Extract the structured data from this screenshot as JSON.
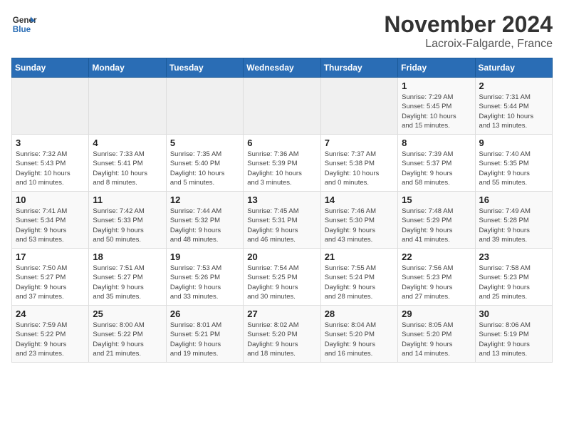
{
  "logo": {
    "line1": "General",
    "line2": "Blue"
  },
  "title": "November 2024",
  "location": "Lacroix-Falgarde, France",
  "days_of_week": [
    "Sunday",
    "Monday",
    "Tuesday",
    "Wednesday",
    "Thursday",
    "Friday",
    "Saturday"
  ],
  "weeks": [
    [
      {
        "day": "",
        "info": ""
      },
      {
        "day": "",
        "info": ""
      },
      {
        "day": "",
        "info": ""
      },
      {
        "day": "",
        "info": ""
      },
      {
        "day": "",
        "info": ""
      },
      {
        "day": "1",
        "info": "Sunrise: 7:29 AM\nSunset: 5:45 PM\nDaylight: 10 hours\nand 15 minutes."
      },
      {
        "day": "2",
        "info": "Sunrise: 7:31 AM\nSunset: 5:44 PM\nDaylight: 10 hours\nand 13 minutes."
      }
    ],
    [
      {
        "day": "3",
        "info": "Sunrise: 7:32 AM\nSunset: 5:43 PM\nDaylight: 10 hours\nand 10 minutes."
      },
      {
        "day": "4",
        "info": "Sunrise: 7:33 AM\nSunset: 5:41 PM\nDaylight: 10 hours\nand 8 minutes."
      },
      {
        "day": "5",
        "info": "Sunrise: 7:35 AM\nSunset: 5:40 PM\nDaylight: 10 hours\nand 5 minutes."
      },
      {
        "day": "6",
        "info": "Sunrise: 7:36 AM\nSunset: 5:39 PM\nDaylight: 10 hours\nand 3 minutes."
      },
      {
        "day": "7",
        "info": "Sunrise: 7:37 AM\nSunset: 5:38 PM\nDaylight: 10 hours\nand 0 minutes."
      },
      {
        "day": "8",
        "info": "Sunrise: 7:39 AM\nSunset: 5:37 PM\nDaylight: 9 hours\nand 58 minutes."
      },
      {
        "day": "9",
        "info": "Sunrise: 7:40 AM\nSunset: 5:35 PM\nDaylight: 9 hours\nand 55 minutes."
      }
    ],
    [
      {
        "day": "10",
        "info": "Sunrise: 7:41 AM\nSunset: 5:34 PM\nDaylight: 9 hours\nand 53 minutes."
      },
      {
        "day": "11",
        "info": "Sunrise: 7:42 AM\nSunset: 5:33 PM\nDaylight: 9 hours\nand 50 minutes."
      },
      {
        "day": "12",
        "info": "Sunrise: 7:44 AM\nSunset: 5:32 PM\nDaylight: 9 hours\nand 48 minutes."
      },
      {
        "day": "13",
        "info": "Sunrise: 7:45 AM\nSunset: 5:31 PM\nDaylight: 9 hours\nand 46 minutes."
      },
      {
        "day": "14",
        "info": "Sunrise: 7:46 AM\nSunset: 5:30 PM\nDaylight: 9 hours\nand 43 minutes."
      },
      {
        "day": "15",
        "info": "Sunrise: 7:48 AM\nSunset: 5:29 PM\nDaylight: 9 hours\nand 41 minutes."
      },
      {
        "day": "16",
        "info": "Sunrise: 7:49 AM\nSunset: 5:28 PM\nDaylight: 9 hours\nand 39 minutes."
      }
    ],
    [
      {
        "day": "17",
        "info": "Sunrise: 7:50 AM\nSunset: 5:27 PM\nDaylight: 9 hours\nand 37 minutes."
      },
      {
        "day": "18",
        "info": "Sunrise: 7:51 AM\nSunset: 5:27 PM\nDaylight: 9 hours\nand 35 minutes."
      },
      {
        "day": "19",
        "info": "Sunrise: 7:53 AM\nSunset: 5:26 PM\nDaylight: 9 hours\nand 33 minutes."
      },
      {
        "day": "20",
        "info": "Sunrise: 7:54 AM\nSunset: 5:25 PM\nDaylight: 9 hours\nand 30 minutes."
      },
      {
        "day": "21",
        "info": "Sunrise: 7:55 AM\nSunset: 5:24 PM\nDaylight: 9 hours\nand 28 minutes."
      },
      {
        "day": "22",
        "info": "Sunrise: 7:56 AM\nSunset: 5:23 PM\nDaylight: 9 hours\nand 27 minutes."
      },
      {
        "day": "23",
        "info": "Sunrise: 7:58 AM\nSunset: 5:23 PM\nDaylight: 9 hours\nand 25 minutes."
      }
    ],
    [
      {
        "day": "24",
        "info": "Sunrise: 7:59 AM\nSunset: 5:22 PM\nDaylight: 9 hours\nand 23 minutes."
      },
      {
        "day": "25",
        "info": "Sunrise: 8:00 AM\nSunset: 5:22 PM\nDaylight: 9 hours\nand 21 minutes."
      },
      {
        "day": "26",
        "info": "Sunrise: 8:01 AM\nSunset: 5:21 PM\nDaylight: 9 hours\nand 19 minutes."
      },
      {
        "day": "27",
        "info": "Sunrise: 8:02 AM\nSunset: 5:20 PM\nDaylight: 9 hours\nand 18 minutes."
      },
      {
        "day": "28",
        "info": "Sunrise: 8:04 AM\nSunset: 5:20 PM\nDaylight: 9 hours\nand 16 minutes."
      },
      {
        "day": "29",
        "info": "Sunrise: 8:05 AM\nSunset: 5:20 PM\nDaylight: 9 hours\nand 14 minutes."
      },
      {
        "day": "30",
        "info": "Sunrise: 8:06 AM\nSunset: 5:19 PM\nDaylight: 9 hours\nand 13 minutes."
      }
    ]
  ]
}
